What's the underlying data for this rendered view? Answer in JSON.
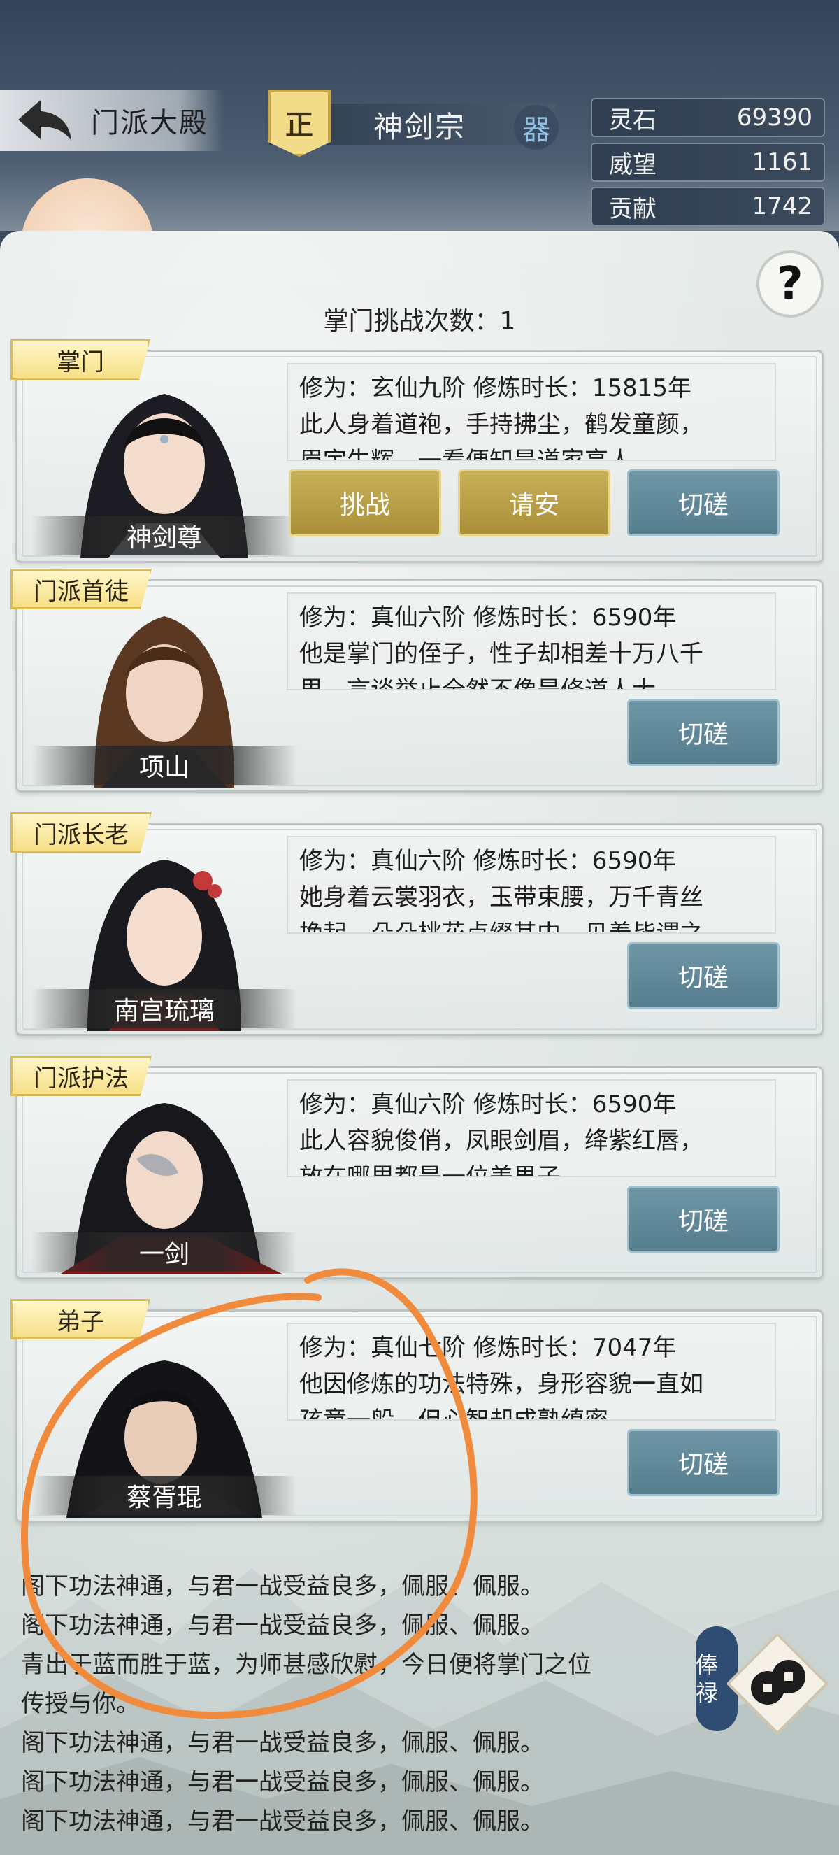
{
  "header": {
    "back_label": "门派大殿",
    "sect_badge": "正",
    "sect_name": "神剑宗",
    "artifact_label": "器"
  },
  "resources": [
    {
      "name": "灵石",
      "value": "69390"
    },
    {
      "name": "威望",
      "value": "1161"
    },
    {
      "name": "贡献",
      "value": "1742"
    }
  ],
  "help_label": "?",
  "challenge_count": "掌门挑战次数：1",
  "members": [
    {
      "rank": "掌门",
      "name": "神剑尊",
      "desc_line1": "修为：玄仙九阶  修炼时长：15815年",
      "desc_line2": "此人身着道袍，手持拂尘，鹤发童颜，",
      "desc_line3": "眉宇生辉，一看便知是道家高人。",
      "buttons": [
        "挑战",
        "请安",
        "切磋"
      ]
    },
    {
      "rank": "门派首徒",
      "name": "项山",
      "desc_line1": "修为：真仙六阶  修炼时长：6590年",
      "desc_line2": "他是掌门的侄子，性子却相差十万八千",
      "desc_line3": "里，言谈举止全然不像是修道人士。",
      "buttons": [
        "切磋"
      ]
    },
    {
      "rank": "门派长老",
      "name": "南宫琉璃",
      "desc_line1": "修为：真仙六阶  修炼时长：6590年",
      "desc_line2": "她身着云裳羽衣，玉带束腰，万千青丝",
      "desc_line3": "挽起，朵朵桃花点缀其中，见着皆谓之",
      "buttons": [
        "切磋"
      ]
    },
    {
      "rank": "门派护法",
      "name": "一剑",
      "desc_line1": "修为：真仙六阶  修炼时长：6590年",
      "desc_line2": "此人容貌俊俏，凤眼剑眉，绛紫红唇，",
      "desc_line3": "放在哪里都是一位美男子。",
      "buttons": [
        "切磋"
      ]
    },
    {
      "rank": "弟子",
      "name": "蔡胥琨",
      "desc_line1": "修为：真仙七阶  修炼时长：7047年",
      "desc_line2": "他因修炼的功法特殊，身形容貌一直如",
      "desc_line3": "孩童一般，但心智却成熟缜密。",
      "buttons": [
        "切磋"
      ]
    }
  ],
  "chat_log": [
    "阁下功法神通，与君一战受益良多，佩服、佩服。",
    "阁下功法神通，与君一战受益良多，佩服、佩服。",
    "青出于蓝而胜于蓝，为师甚感欣慰，今日便将掌门之位",
    "传授与你。",
    "阁下功法神通，与君一战受益良多，佩服、佩服。",
    "阁下功法神通，与君一战受益良多，佩服、佩服。",
    "阁下功法神通，与君一战受益良多，佩服、佩服。"
  ],
  "salary_label": "俸禄",
  "colors": {
    "gold_button": "#b59c45",
    "blue_button": "#628a9b",
    "annotation_stroke": "#f08a3c"
  }
}
